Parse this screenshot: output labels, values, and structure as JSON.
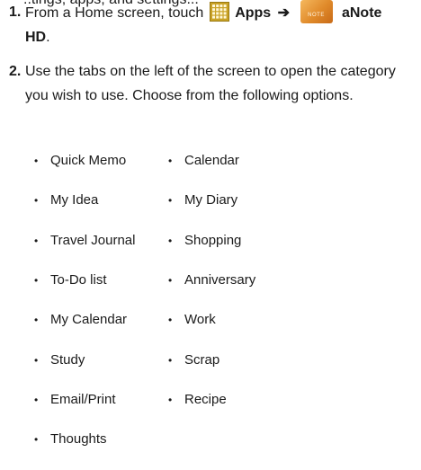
{
  "cutoff_line": "..tings, apps, and settings...",
  "steps": [
    {
      "number": "1.",
      "prefix": "From a Home screen, touch",
      "apps_label": "Apps",
      "arrow": "➔",
      "note_icon_text": "NOTE",
      "app_name": "aNote HD",
      "suffix": "."
    },
    {
      "number": "2.",
      "text": "Use the tabs on the left of the screen to open the category you wish to use. Choose from the following options."
    }
  ],
  "options_left": [
    "Quick Memo",
    "My Idea",
    "Travel Journal",
    "To-Do list",
    "My Calendar",
    "Study",
    "Email/Print",
    "Thoughts"
  ],
  "options_right": [
    "Calendar",
    "My Diary",
    "Shopping",
    "Anniversary",
    "Work",
    "Scrap",
    "Recipe"
  ],
  "icons": [
    "apps-grid-icon",
    "anote-app-icon"
  ],
  "colors": {
    "apps_icon": "#c9a227",
    "anote_icon": "#e08a2a",
    "text": "#1a1a1a"
  }
}
